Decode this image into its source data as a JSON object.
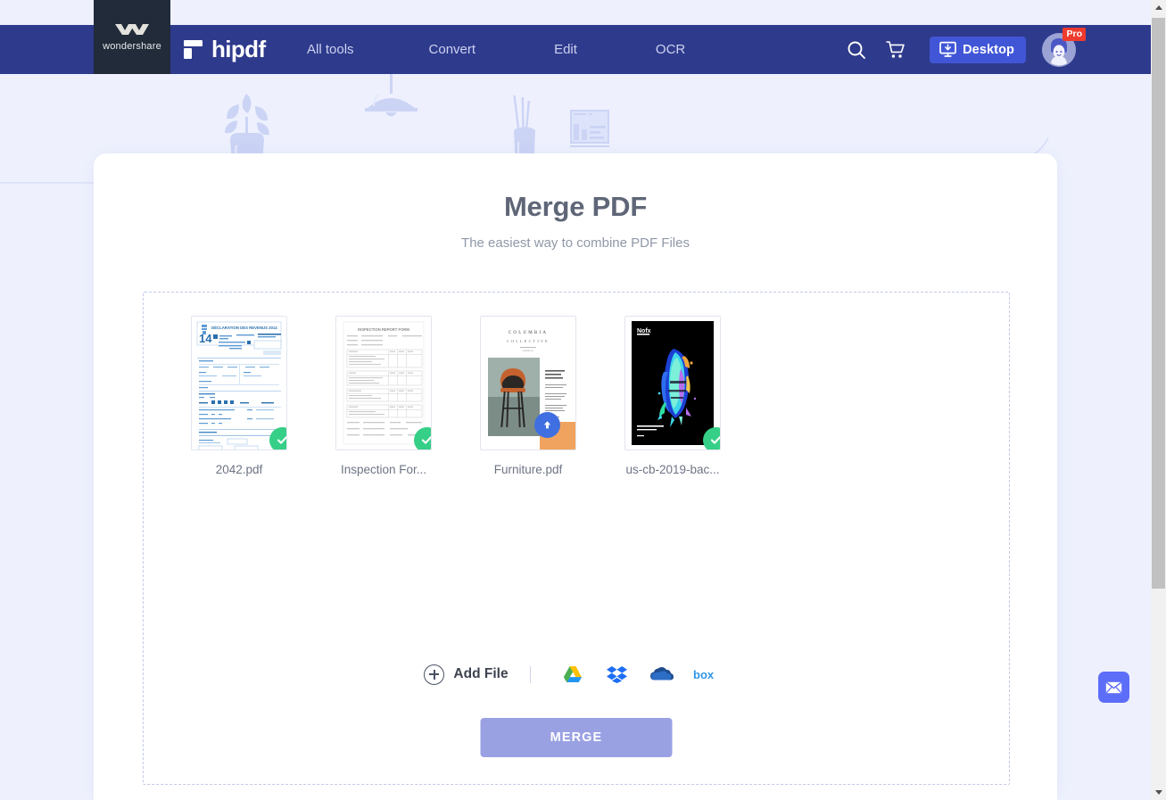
{
  "header": {
    "brand": {
      "name": "wondershare",
      "mark_icon": "wondershare-logo-icon"
    },
    "logo": {
      "text": "hipdf",
      "mark_icon": "hipdf-logo-icon"
    },
    "nav": [
      {
        "label": "All tools",
        "name": "nav-all-tools"
      },
      {
        "label": "Convert",
        "name": "nav-convert"
      },
      {
        "label": "Edit",
        "name": "nav-edit"
      },
      {
        "label": "OCR",
        "name": "nav-ocr"
      }
    ],
    "search_icon": "search-icon",
    "cart_icon": "shopping-cart-icon",
    "desktop_button": {
      "label": "Desktop",
      "icon": "monitor-download-icon",
      "color": "#4156d6"
    },
    "avatar": {
      "icon": "user-avatar-icon",
      "badge": "Pro",
      "badge_color": "#ef3b2d"
    },
    "background_color": "#2e3a8c"
  },
  "main": {
    "title": "Merge PDF",
    "subtitle": "The easiest way to combine PDF Files",
    "files": [
      {
        "name": "2042.pdf",
        "status": "done",
        "status_icon": "check-circle-icon",
        "thumb": "french-tax-form-2042"
      },
      {
        "name": "Inspection For...",
        "status": "done",
        "status_icon": "check-circle-icon",
        "thumb": "inspection-report-form"
      },
      {
        "name": "Furniture.pdf",
        "status": "uploading",
        "status_icon": "upload-arrow-icon",
        "thumb": "columbia-collective-brochure"
      },
      {
        "name": "us-cb-2019-bac...",
        "status": "done",
        "status_icon": "check-circle-icon",
        "thumb": "album-cover-dark"
      }
    ],
    "add_file": {
      "label": "Add File",
      "icon": "plus-circle-icon"
    },
    "cloud_sources": [
      {
        "label": "Google Drive",
        "icon": "google-drive-icon"
      },
      {
        "label": "Dropbox",
        "icon": "dropbox-icon"
      },
      {
        "label": "OneDrive",
        "icon": "onedrive-icon"
      },
      {
        "label": "Box",
        "icon": "box-icon"
      }
    ],
    "merge_button": {
      "label": "MERGE",
      "color": "#9aa1e3",
      "disabled": true
    }
  },
  "widgets": {
    "mail": {
      "icon": "envelope-icon",
      "color": "#5c6ef8"
    }
  },
  "thumbnail_text": {
    "tax_form": {
      "title": "DÉCLARATION DES REVENUS 2014",
      "year": "14"
    },
    "inspection": {
      "title": "INSPECTION REPORT FORM"
    },
    "furniture": {
      "brand": "COLUMBIA",
      "sub": "COLLECTIVE"
    },
    "album": {
      "brand": "Nofx"
    }
  },
  "scrollbar": {
    "up_icon": "scroll-up-arrow-icon",
    "down_icon": "scroll-down-arrow-icon"
  }
}
